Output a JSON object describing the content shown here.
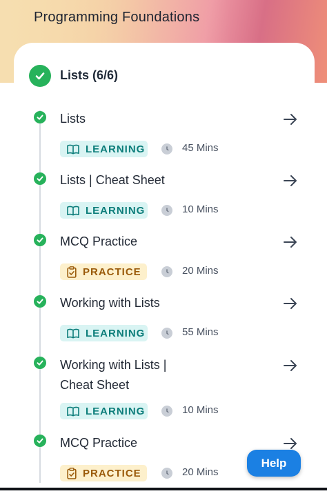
{
  "header": {
    "title": "Programming Foundations"
  },
  "section": {
    "title": "Lists (6/6)"
  },
  "items": [
    {
      "title": "Lists",
      "type": "LEARNING",
      "duration": "45 Mins"
    },
    {
      "title": "Lists | Cheat Sheet",
      "type": "LEARNING",
      "duration": "10 Mins"
    },
    {
      "title": "MCQ Practice",
      "type": "PRACTICE",
      "duration": "20 Mins"
    },
    {
      "title": "Working with Lists",
      "type": "LEARNING",
      "duration": "55 Mins"
    },
    {
      "title": "Working with Lists | Cheat Sheet",
      "type": "LEARNING",
      "duration": "10 Mins"
    },
    {
      "title": "MCQ Practice",
      "type": "PRACTICE",
      "duration": "20 Mins"
    }
  ],
  "help": {
    "label": "Help"
  },
  "icons": {
    "completed": "check-circle-icon",
    "learning": "book-open-icon",
    "practice": "clipboard-check-icon",
    "duration": "clock-icon",
    "open": "arrow-right-icon"
  },
  "colors": {
    "completed": "#27b25b",
    "learning_bg": "#d9f4f3",
    "learning_text": "#0c7d7a",
    "practice_bg": "#fdf0cc",
    "practice_text": "#9a5a0a",
    "help_button": "#1b80e3"
  }
}
